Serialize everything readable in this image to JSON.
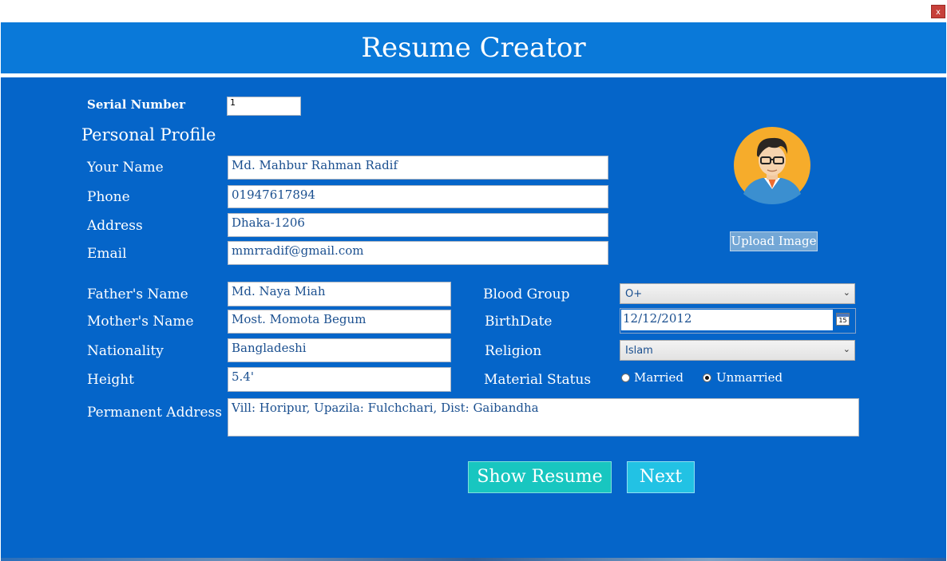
{
  "window": {
    "close_label": "x"
  },
  "header": {
    "title": "Resume Creator"
  },
  "serial": {
    "label": "Serial Number",
    "value": "1"
  },
  "personal_profile": {
    "heading": "Personal Profile",
    "name": {
      "label": "Your Name",
      "value": "Md. Mahbur Rahman Radif"
    },
    "phone": {
      "label": "Phone",
      "value": "01947617894"
    },
    "address": {
      "label": "Address",
      "value": "Dhaka-1206"
    },
    "email": {
      "label": "Email",
      "value": "mmrradif@gmail.com"
    }
  },
  "family": {
    "father": {
      "label": "Father's Name",
      "value": "Md. Naya Miah"
    },
    "mother": {
      "label": "Mother's Name",
      "value": "Most. Momota Begum"
    },
    "nationality": {
      "label": "Nationality",
      "value": "Bangladeshi"
    },
    "height": {
      "label": "Height",
      "value": "5.4'"
    },
    "permanent_address": {
      "label": "Permanent Address",
      "value": "Vill: Horipur, Upazila: Fulchchari, Dist: Gaibandha"
    }
  },
  "details": {
    "blood_group": {
      "label": "Blood Group",
      "value": "O+"
    },
    "birthdate": {
      "label": "BirthDate",
      "value": "12/12/2012",
      "calendar_day": "15"
    },
    "religion": {
      "label": "Religion",
      "value": "Islam"
    },
    "marital_status": {
      "label": "Material Status",
      "options": [
        "Married",
        "Unmarried"
      ],
      "selected": "Unmarried"
    }
  },
  "profile_image": {
    "icon": "user-avatar-icon",
    "upload_label": "Upload Image"
  },
  "actions": {
    "show_resume_label": "Show Resume",
    "next_label": "Next"
  },
  "colors": {
    "background": "#0565c9",
    "header": "#0a79d9",
    "show_button": "#18c6c0",
    "next_button": "#22c2e4"
  }
}
